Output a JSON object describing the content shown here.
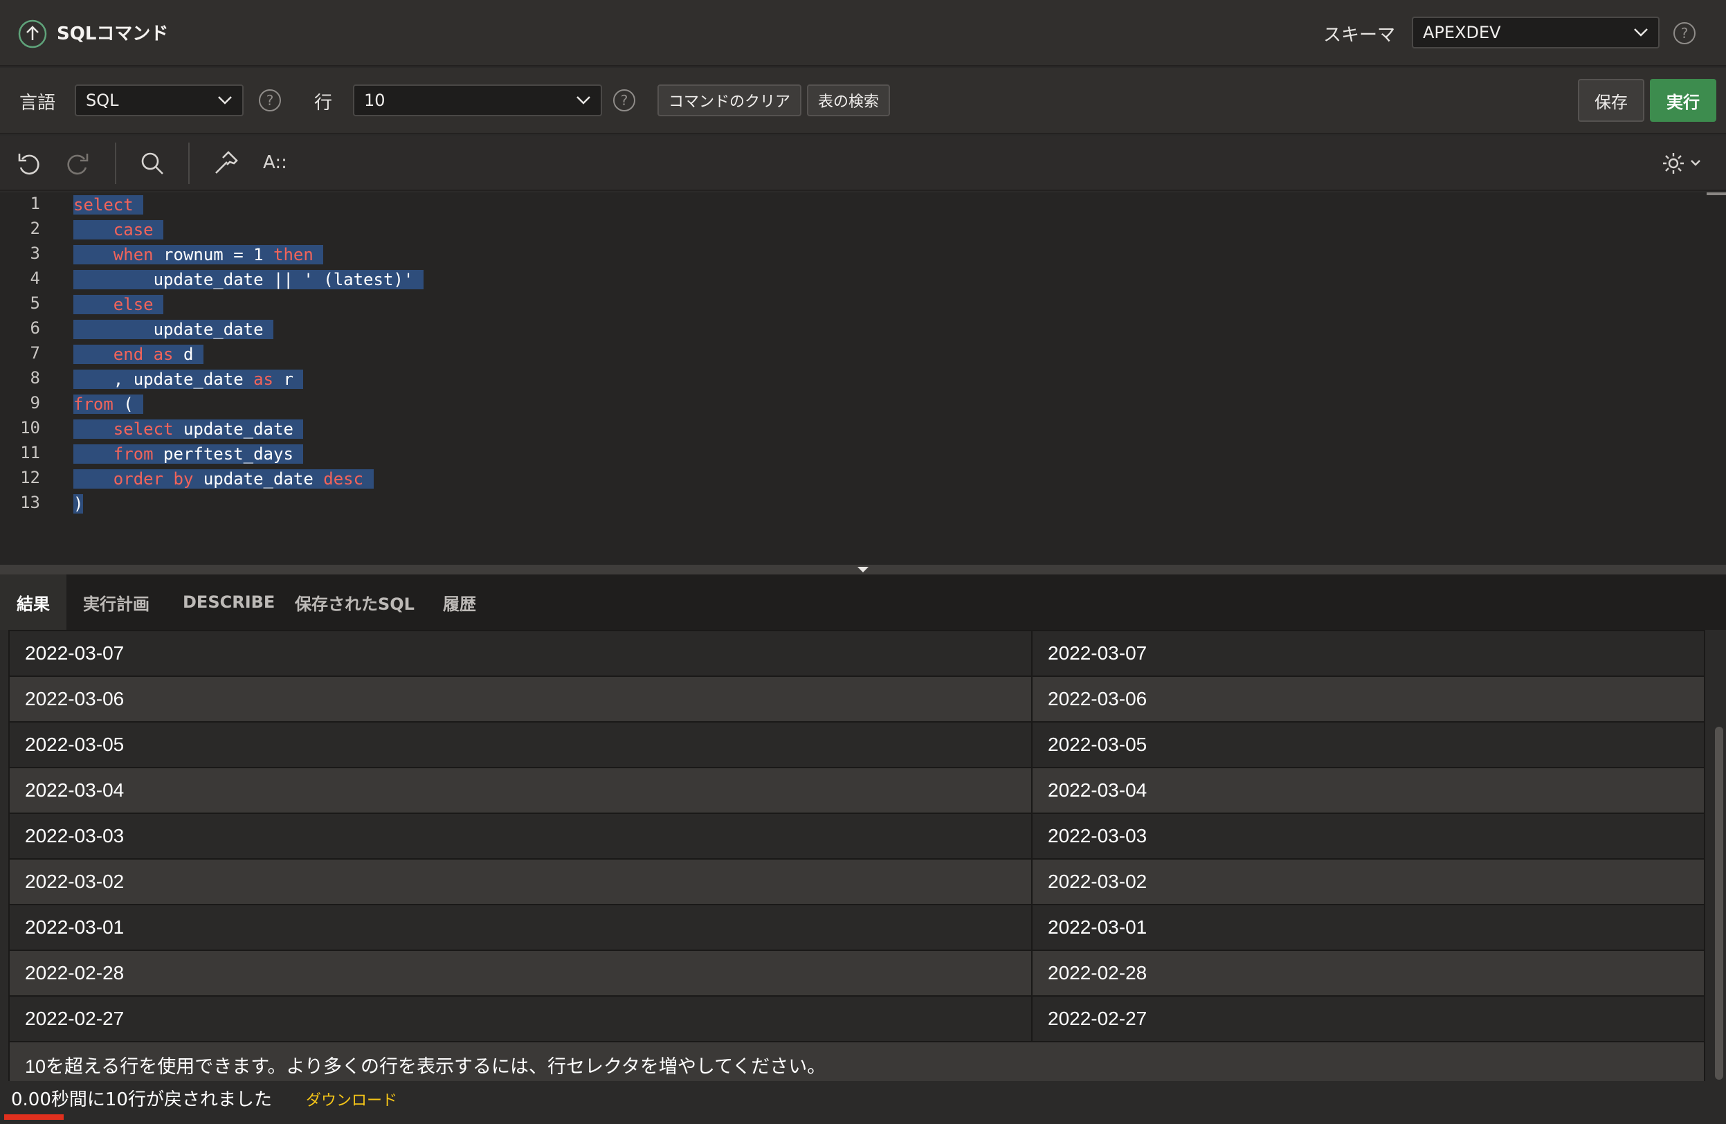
{
  "header": {
    "title": "SQLコマンド",
    "schema_label": "スキーマ",
    "schema_value": "APEXDEV"
  },
  "toolbar": {
    "language_label": "言語",
    "language_value": "SQL",
    "rows_label": "行",
    "rows_value": "10",
    "clear_label": "コマンドのクリア",
    "find_table_label": "表の検索",
    "save_label": "保存",
    "run_label": "実行"
  },
  "editor": {
    "line_numbers": [
      "1",
      "2",
      "3",
      "4",
      "5",
      "6",
      "7",
      "8",
      "9",
      "10",
      "11",
      "12",
      "13"
    ],
    "format_label": "A::"
  },
  "tabs": [
    "結果",
    "実行計画",
    "DESCRIBE",
    "保存されたSQL",
    "履歴"
  ],
  "results": {
    "rows": [
      [
        "2022-03-07",
        "2022-03-07"
      ],
      [
        "2022-03-06",
        "2022-03-06"
      ],
      [
        "2022-03-05",
        "2022-03-05"
      ],
      [
        "2022-03-04",
        "2022-03-04"
      ],
      [
        "2022-03-03",
        "2022-03-03"
      ],
      [
        "2022-03-02",
        "2022-03-02"
      ],
      [
        "2022-03-01",
        "2022-03-01"
      ],
      [
        "2022-02-28",
        "2022-02-28"
      ],
      [
        "2022-02-27",
        "2022-02-27"
      ]
    ],
    "more_rows_note": "10を超える行を使用できます。より多くの行を表示するには、行セレクタを増やしてください。"
  },
  "footer": {
    "status": "0.00秒間に10行が戻されました",
    "download_label": "ダウンロード"
  },
  "colors": {
    "run_button": "#3d8c4e",
    "keyword": "#f2645a",
    "selection": "#2e4d7b",
    "download_link": "#f5c518",
    "progress_bar": "#e0301e"
  }
}
